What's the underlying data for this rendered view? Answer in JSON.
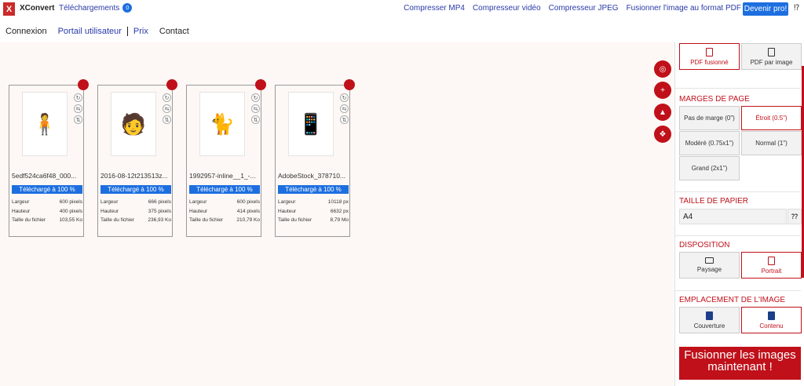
{
  "topbar": {
    "logo": "X",
    "brand": "XConvert",
    "downloads_label": "Téléchargements",
    "downloads_count": "0",
    "links": [
      "Compresser MP4",
      "Compresseur vidéo",
      "Compresseur JPEG",
      "Fusionner l'image au format PDF"
    ],
    "pro_button": "Devenir pro!",
    "help": "⁉"
  },
  "nav": {
    "login": "Connexion",
    "portal": "Portail utilisateur",
    "pricing": "Prix",
    "contact": "Contact"
  },
  "files": [
    {
      "name": "5edf524ca6f48_000...",
      "progress": "Téléchargé à 100 %",
      "width_label": "Largeur",
      "width": "600 pixels",
      "height_label": "Hauteur",
      "height": "400 pixels",
      "size_label": "Taille du fichier",
      "size": "103,55 Ko",
      "thumb": "🧍"
    },
    {
      "name": "2016-08-12t213513z...",
      "progress": "Téléchargé à 100 %",
      "width_label": "Largeur",
      "width": "666 pixels",
      "height_label": "Hauteur",
      "height": "375 pixels",
      "size_label": "Taille du fichier",
      "size": "236,93 Ko",
      "thumb": "🧑"
    },
    {
      "name": "1992957-inline__1_-...",
      "progress": "Téléchargé à 100 %",
      "width_label": "Largeur",
      "width": "600 pixels",
      "height_label": "Hauteur",
      "height": "414 pixels",
      "size_label": "Taille du fichier",
      "size": "210,79 Ko",
      "thumb": "🐈"
    },
    {
      "name": "AdobeStock_378710...",
      "progress": "Téléchargé à 100 %",
      "width_label": "Largeur",
      "width": "10118 px",
      "height_label": "Hauteur",
      "height": "6632 px",
      "size_label": "Taille du fichier",
      "size": "8,79 Mo",
      "thumb": "📱"
    }
  ],
  "panel": {
    "pdf_merged": "PDF fusionné",
    "pdf_per_image": "PDF par image",
    "margins_title": "MARGES DE PAGE",
    "margin_none": "Pas de marge (0\")",
    "margin_narrow": "Étroit (0.5\")",
    "margin_moderate": "Modéré (0.75x1\")",
    "margin_normal": "Normal (1\")",
    "margin_large": "Grand (2x1\")",
    "paper_title": "TAILLE DE PAPIER",
    "paper_value": "A4",
    "paper_help": "⁇",
    "layout_title": "DISPOSITION",
    "landscape": "Paysage",
    "portrait": "Portrait",
    "placement_title": "EMPLACEMENT DE L'IMAGE",
    "cover": "Couverture",
    "contain": "Contenu",
    "merge_button": "Fusionner les images maintenant !"
  }
}
